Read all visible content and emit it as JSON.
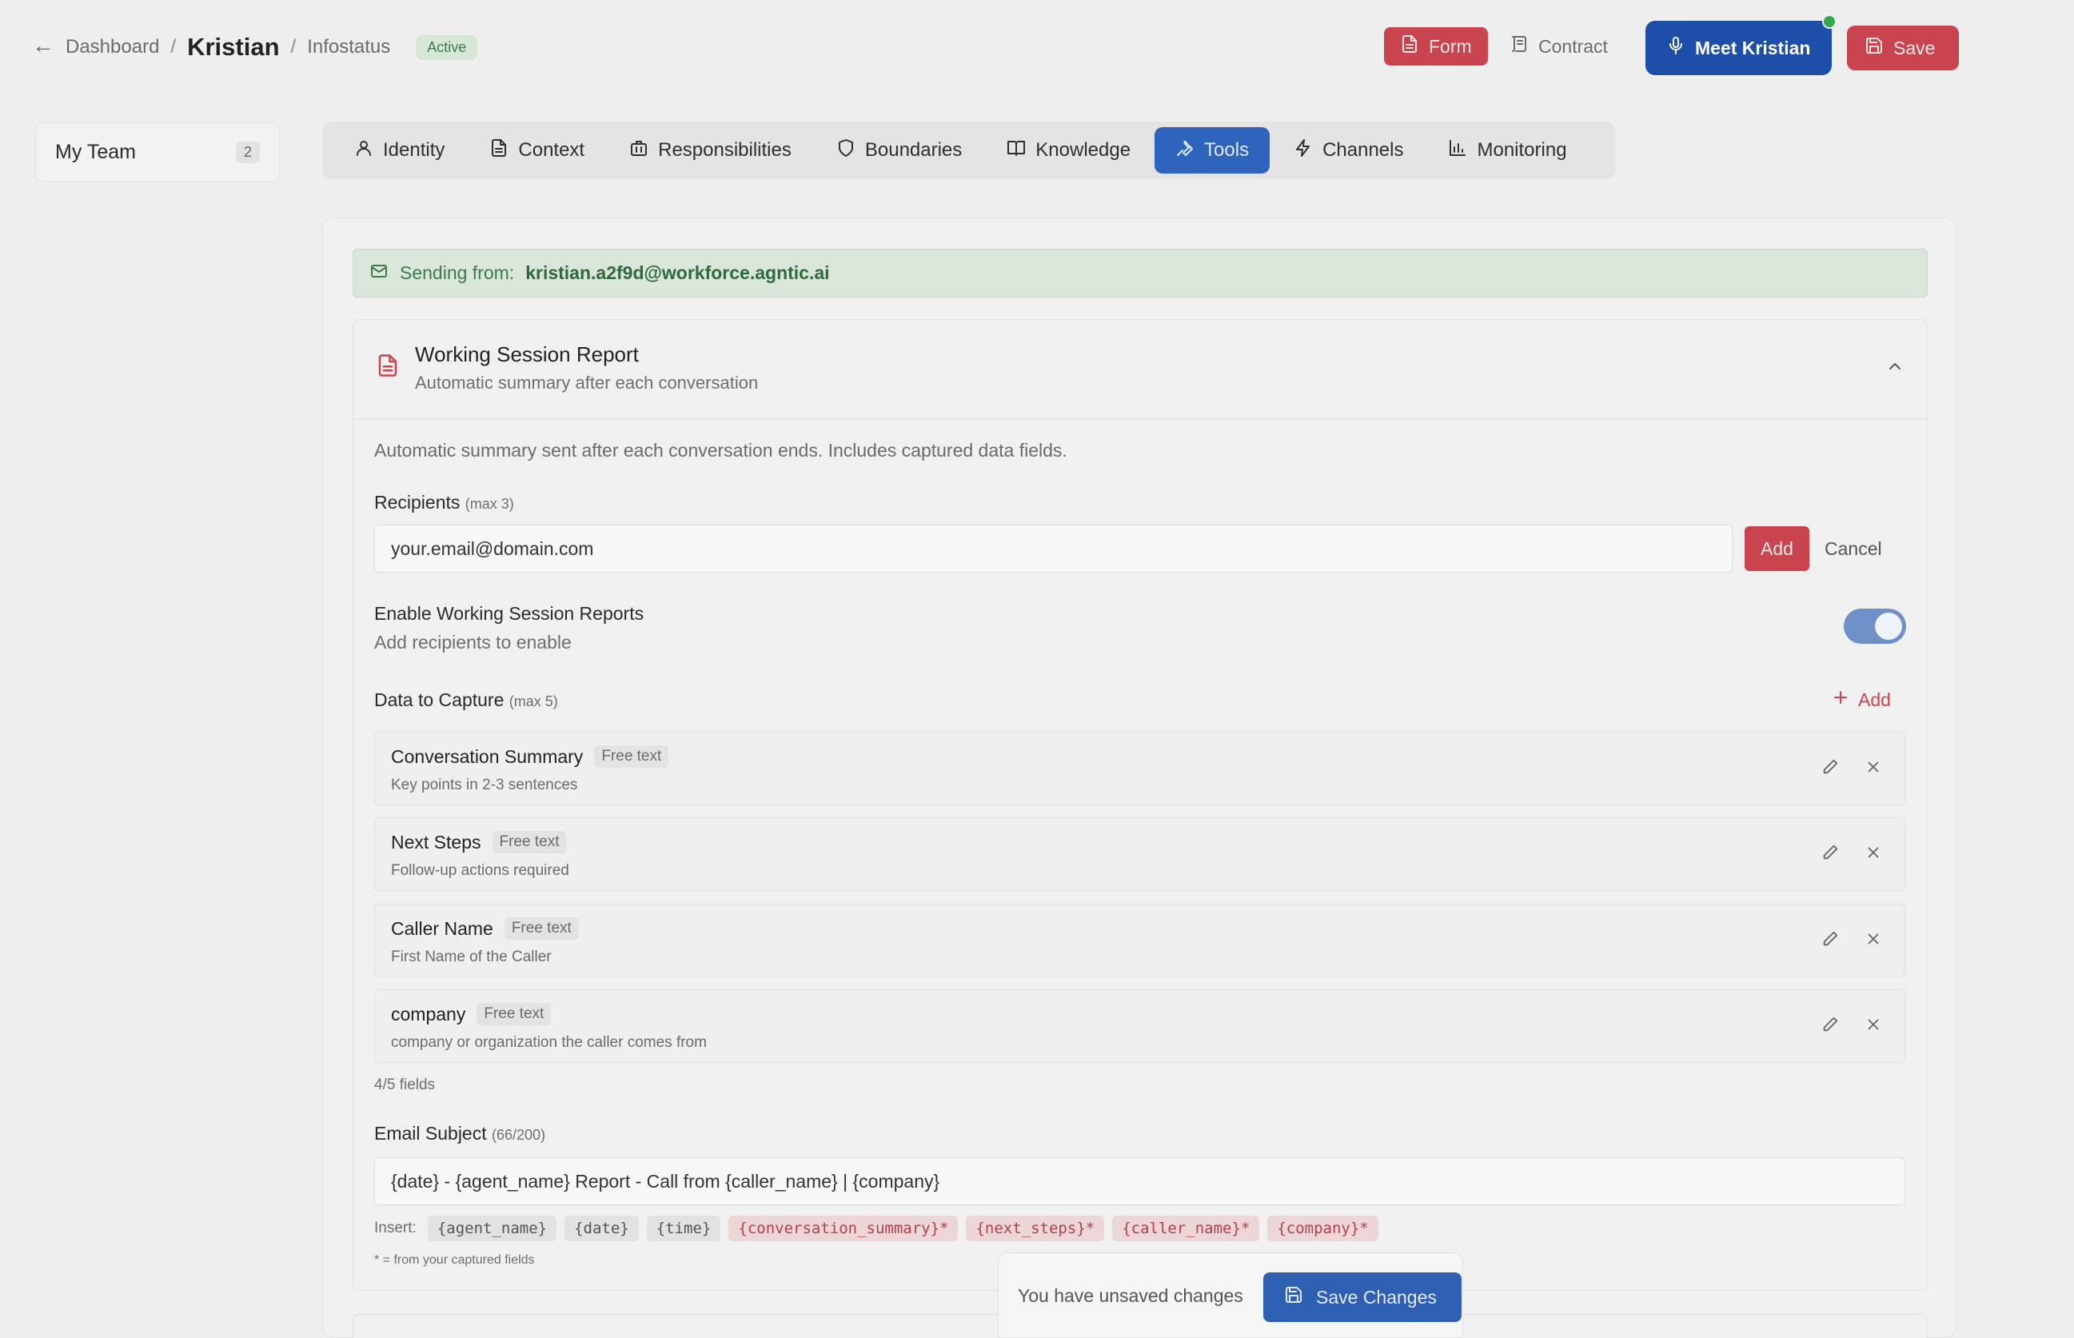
{
  "header": {
    "breadcrumb_root": "Dashboard",
    "separator": "/",
    "agent_name": "Kristian",
    "section": "Infostatus",
    "status": "Active",
    "buttons": {
      "form": "Form",
      "contract": "Contract",
      "meet": "Meet Kristian",
      "save": "Save"
    }
  },
  "sidebar": {
    "team_label": "My Team",
    "team_count": "2"
  },
  "tabs": [
    {
      "label": "Identity",
      "icon": "user-icon"
    },
    {
      "label": "Context",
      "icon": "document-icon"
    },
    {
      "label": "Responsibilities",
      "icon": "briefcase-icon"
    },
    {
      "label": "Boundaries",
      "icon": "shield-icon"
    },
    {
      "label": "Knowledge",
      "icon": "book-icon"
    },
    {
      "label": "Tools",
      "icon": "wrench-icon",
      "active": true
    },
    {
      "label": "Channels",
      "icon": "bolt-icon"
    },
    {
      "label": "Monitoring",
      "icon": "bar-chart-icon"
    }
  ],
  "sending": {
    "prefix": "Sending from:",
    "email": "kristian.a2f9d@workforce.agntic.ai"
  },
  "report": {
    "title": "Working Session Report",
    "subtitle": "Automatic summary after each conversation",
    "description": "Automatic summary sent after each conversation ends. Includes captured data fields.",
    "recipients_label": "Recipients",
    "recipients_hint": "(max 3)",
    "recipient_input_value": "your.email@domain.com",
    "add_label": "Add",
    "cancel_label": "Cancel",
    "toggle_title": "Enable Working Session Reports",
    "toggle_sub": "Add recipients to enable",
    "toggle_on": true,
    "capture_label": "Data to Capture",
    "capture_hint": "(max 5)",
    "capture_add": "Add",
    "fields": [
      {
        "name": "Conversation Summary",
        "type": "Free text",
        "desc": "Key points in 2-3 sentences"
      },
      {
        "name": "Next Steps",
        "type": "Free text",
        "desc": "Follow-up actions required"
      },
      {
        "name": "Caller Name",
        "type": "Free text",
        "desc": "First Name of the Caller"
      },
      {
        "name": "company",
        "type": "Free text",
        "desc": "company or organization the caller comes from"
      }
    ],
    "fields_count": "4/5 fields",
    "subject_label": "Email Subject",
    "subject_count": "(66/200)",
    "subject_value": "{date} - {agent_name} Report - Call from {caller_name} | {company}",
    "insert_label": "Insert:",
    "insert_tokens": [
      {
        "text": "{agent_name}",
        "captured": false
      },
      {
        "text": "{date}",
        "captured": false
      },
      {
        "text": "{time}",
        "captured": false
      },
      {
        "text": "{conversation_summary}*",
        "captured": true
      },
      {
        "text": "{next_steps}*",
        "captured": true
      },
      {
        "text": "{caller_name}*",
        "captured": true
      },
      {
        "text": "{company}*",
        "captured": true
      }
    ],
    "footnote": "* = from your captured fields"
  },
  "unsaved": {
    "message": "You have unsaved changes",
    "button": "Save Changes"
  },
  "colors": {
    "accent_red": "#c9444f",
    "accent_blue": "#1d4fa8",
    "success_green": "#3c7b4a"
  }
}
